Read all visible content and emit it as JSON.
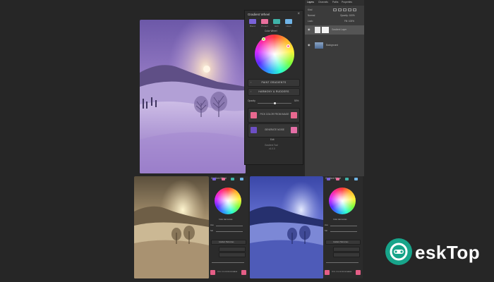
{
  "gradient_panel": {
    "title": "Gradient Wheel",
    "close": "×",
    "modes": [
      {
        "label": "Blend",
        "color": "#7a62d8"
      },
      {
        "label": "Protect",
        "color": "#e86f9c"
      },
      {
        "label": "Edit",
        "color": "#3fb3a8"
      },
      {
        "label": "Hues",
        "color": "#6fb4e6"
      }
    ],
    "section_label": "Color Wheel",
    "rows": [
      {
        "label": "PAINT GRADIENTS"
      },
      {
        "label": "HARMONY & RUDDERS"
      }
    ],
    "opacity_label": "Opacity",
    "opacity_value": "50%",
    "pick_button": {
      "label": "PICK COLOR FROM IMAGE",
      "left_swatch": "#e8688f",
      "right_swatch": "#e8688f"
    },
    "generate_button": {
      "label": "GENERATE NOISE",
      "left_swatch": "#6d4fc4",
      "right_swatch": "#e46fa6"
    },
    "footer_small": "Edit",
    "footer_line1": "Gradient Tool",
    "footer_line2": "v1.0.0"
  },
  "layers_panel": {
    "tabs": [
      "Layers",
      "Channels",
      "Paths",
      "Properties"
    ],
    "search_placeholder": "Kind",
    "blend_mode": "Normal",
    "opacity_text": "Opacity: 100%",
    "lock_text": "Lock:",
    "fill_text": "Fill: 100%",
    "layers": [
      {
        "name": "Gradient Layer",
        "visible": true,
        "selected": true
      },
      {
        "name": "Background",
        "visible": true,
        "selected": false
      }
    ]
  },
  "mini_panels": [
    {
      "title": "Gradient Wheel",
      "row1": "Color Harmonies",
      "row2": "Gradient Harmonies",
      "field1": "Hue",
      "field2": "Sat",
      "pick": "PICK COLOR FROM IMAGE",
      "left_swatch": "#e45e86",
      "right_swatch": "#e45e86"
    },
    {
      "title": "Gradient Wheel",
      "row1": "Color Harmonies",
      "row2": "Gradient Harmonies",
      "field1": "Hue",
      "field2": "Sat",
      "pick": "PICK COLOR FROM IMAGE",
      "left_swatch": "#e45e86",
      "right_swatch": "#e45e86"
    }
  ],
  "watermark": {
    "text": "eskTop",
    "colors": {
      "circle": "#17a48a",
      "text": "#ffffff"
    }
  }
}
